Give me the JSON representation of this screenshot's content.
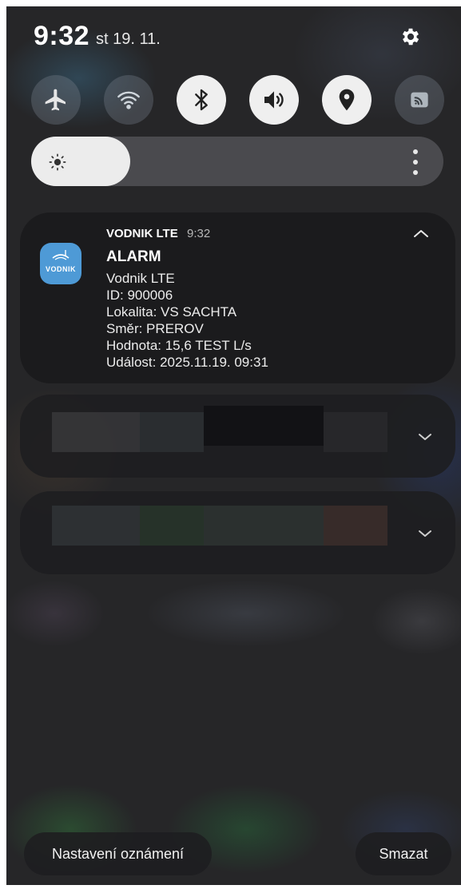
{
  "status": {
    "time": "9:32",
    "date": "st 19. 11."
  },
  "quick_settings": {
    "toggles": [
      {
        "name": "airplane",
        "icon": "airplane-icon",
        "state": "off"
      },
      {
        "name": "wifi",
        "icon": "wifi-icon",
        "state": "off"
      },
      {
        "name": "bluetooth",
        "icon": "bluetooth-icon",
        "state": "on"
      },
      {
        "name": "sound",
        "icon": "sound-icon",
        "state": "on"
      },
      {
        "name": "location",
        "icon": "location-icon",
        "state": "on"
      },
      {
        "name": "cast",
        "icon": "cast-icon",
        "state": "off"
      }
    ],
    "brightness_level": 0.24,
    "settings_icon": "gear-icon"
  },
  "notification": {
    "app_name": "VODNIK LTE",
    "time": "9:32",
    "icon_label": "VODNIK",
    "title": "ALARM",
    "lines": [
      "Vodnik LTE",
      "ID: 900006",
      "Lokalita: VS SACHTA",
      "Směr: PREROV",
      "Hodnota: 15,6 TEST L/s",
      "Událost: 2025.11.19. 09:31"
    ]
  },
  "footer": {
    "settings_label": "Nastavení oznámení",
    "clear_label": "Smazat"
  },
  "colors": {
    "app_icon": "#4e9ad6",
    "toggle_on": "#efefef",
    "background": "#262628"
  }
}
